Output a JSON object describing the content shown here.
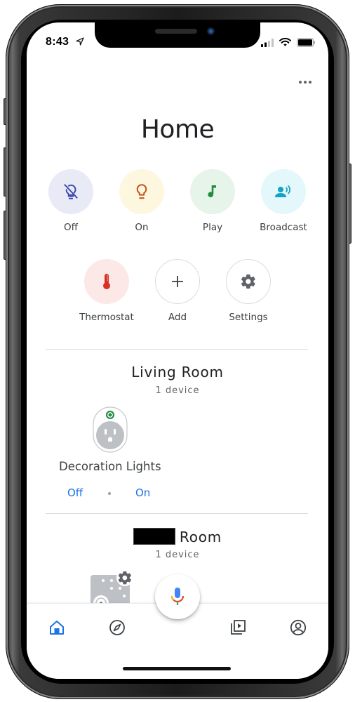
{
  "status_bar": {
    "time": "8:43",
    "icons": [
      "location-arrow-icon",
      "cellular-signal-icon",
      "wifi-icon",
      "battery-icon"
    ]
  },
  "header": {
    "more_icon": "more-horizontal-icon",
    "title": "Home"
  },
  "actions": [
    {
      "label": "Off",
      "icon": "lightbulb-off-icon",
      "bg": "#e8eaf6",
      "fg": "#3949ab"
    },
    {
      "label": "On",
      "icon": "lightbulb-icon",
      "bg": "#fef7e0",
      "fg": "#c5561e"
    },
    {
      "label": "Play",
      "icon": "music-note-icon",
      "bg": "#e6f4ea",
      "fg": "#1e8e3e"
    },
    {
      "label": "Broadcast",
      "icon": "broadcast-icon",
      "bg": "#e4f7fb",
      "fg": "#12a4c3"
    },
    {
      "label": "Thermostat",
      "icon": "thermometer-icon",
      "bg": "#fce8e6",
      "fg": "#d93025"
    },
    {
      "label": "Add",
      "icon": "plus-icon",
      "bg": "#ffffff",
      "fg": "#3c4043"
    },
    {
      "label": "Settings",
      "icon": "gear-icon",
      "bg": "#ffffff",
      "fg": "#5f6368"
    }
  ],
  "rooms": [
    {
      "title": "Living Room",
      "subtitle": "1 device",
      "devices": [
        {
          "name": "Decoration Lights",
          "icon": "smart-plug-icon",
          "controls": [
            "Off",
            "On"
          ]
        }
      ]
    },
    {
      "title": "Room",
      "title_redacted_prefix": true,
      "subtitle": "1 device",
      "devices": [
        {
          "icon": "smart-device-settings-icon"
        }
      ]
    }
  ],
  "assistant": {
    "icon": "microphone-icon"
  },
  "bottom_nav": [
    {
      "name": "home",
      "icon": "home-icon",
      "active": true
    },
    {
      "name": "discover",
      "icon": "compass-icon",
      "active": false
    },
    {
      "name": "media",
      "icon": "media-library-icon",
      "active": false
    },
    {
      "name": "account",
      "icon": "account-circle-icon",
      "active": false
    }
  ],
  "colors": {
    "accent": "#1a73e8",
    "text_primary": "#202124",
    "text_secondary": "#5f6368",
    "divider": "#dadce0"
  }
}
